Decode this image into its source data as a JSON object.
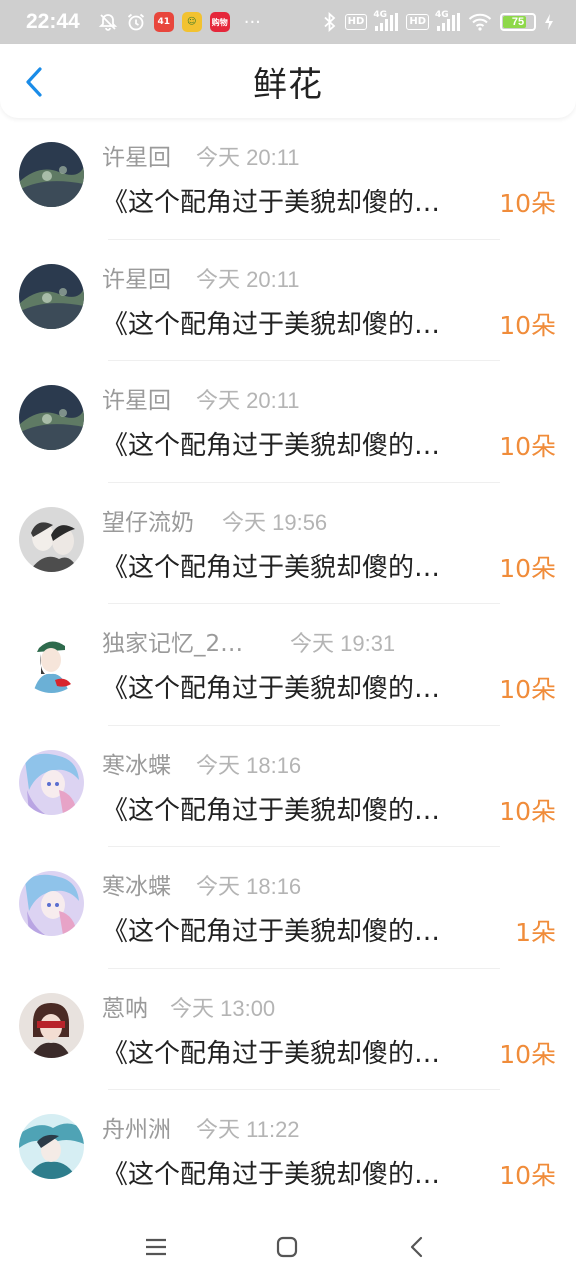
{
  "status_bar": {
    "time": "22:44",
    "battery": "75",
    "icons": [
      "mute-icon",
      "alarm-icon",
      "app-icon-1",
      "app-icon-2",
      "app-icon-3",
      "more-icon",
      "bluetooth-icon",
      "hd-icon",
      "signal-4g-icon",
      "wifi-icon",
      "battery-icon",
      "charging-icon"
    ],
    "app_badges": [
      "41",
      "☺",
      "购物"
    ],
    "more": "···",
    "hd": "HD",
    "net": "4G"
  },
  "header": {
    "title": "鲜花",
    "back_icon": "chevron-left-icon"
  },
  "colors": {
    "accent": "#1a8ce8",
    "amount": "#f08c3a",
    "name": "#9a9a9a",
    "time": "#b4b4b4"
  },
  "list": [
    {
      "name": "许星回",
      "time": "今天 20:11",
      "message": "《这个配角过于美貌却傻的…",
      "amount": "10朵"
    },
    {
      "name": "许星回",
      "time": "今天 20:11",
      "message": "《这个配角过于美貌却傻的…",
      "amount": "10朵"
    },
    {
      "name": "许星回",
      "time": "今天 20:11",
      "message": "《这个配角过于美貌却傻的…",
      "amount": "10朵"
    },
    {
      "name": "望仔流奶",
      "time": "今天 19:56",
      "message": "《这个配角过于美貌却傻的…",
      "amount": "10朵"
    },
    {
      "name": "独家记忆_2…",
      "time": "今天 19:31",
      "message": "《这个配角过于美貌却傻的…",
      "amount": "10朵"
    },
    {
      "name": "寒冰蝶",
      "time": "今天 18:16",
      "message": "《这个配角过于美貌却傻的…",
      "amount": "10朵"
    },
    {
      "name": "寒冰蝶",
      "time": "今天 18:16",
      "message": "《这个配角过于美貌却傻的…",
      "amount": "1朵"
    },
    {
      "name": "蒽呐",
      "time": "今天 13:00",
      "message": "《这个配角过于美貌却傻的…",
      "amount": "10朵"
    },
    {
      "name": "舟州洲",
      "time": "今天 11:22",
      "message": "《这个配角过于美貌却傻的…",
      "amount": "10朵"
    }
  ],
  "nav_bar": {
    "icons": [
      "menu-icon",
      "home-icon",
      "back-icon"
    ]
  }
}
